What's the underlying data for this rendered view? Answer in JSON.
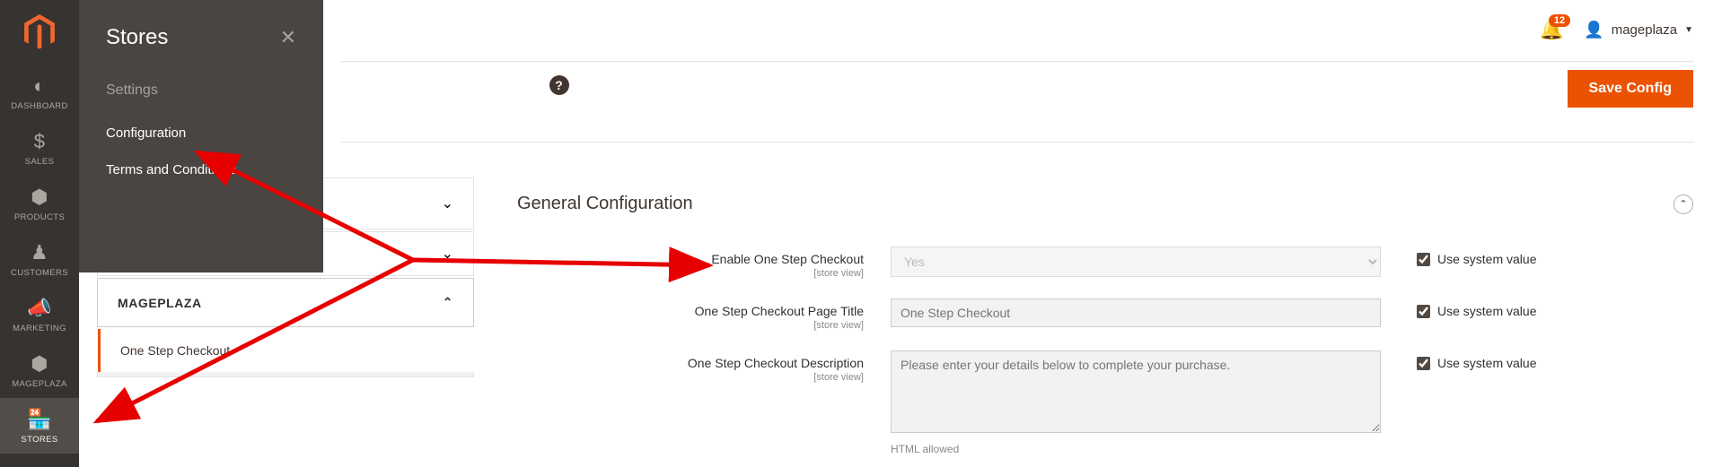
{
  "nav": {
    "items": [
      {
        "icon": "dashboard",
        "label": "DASHBOARD"
      },
      {
        "icon": "dollar",
        "label": "SALES"
      },
      {
        "icon": "cube",
        "label": "PRODUCTS"
      },
      {
        "icon": "person",
        "label": "CUSTOMERS"
      },
      {
        "icon": "megaphone",
        "label": "MARKETING"
      },
      {
        "icon": "cube",
        "label": "MAGEPLAZA"
      },
      {
        "icon": "store",
        "label": "STORES"
      }
    ],
    "active_index": 6
  },
  "flyout": {
    "title": "Stores",
    "section": "Settings",
    "links": [
      "Configuration",
      "Terms and Conditions"
    ]
  },
  "topbar": {
    "notif_count": "12",
    "user": "mageplaza"
  },
  "action": {
    "save_label": "Save Config"
  },
  "config_sidebar": {
    "expanded_section": "MAGEPLAZA",
    "active_item": "One Step Checkout"
  },
  "group": {
    "title": "General Configuration",
    "fields": {
      "enable": {
        "label": "Enable One Step Checkout",
        "scope": "[store view]",
        "value": "Yes",
        "use_system": true,
        "use_system_label": "Use system value"
      },
      "page_title": {
        "label": "One Step Checkout Page Title",
        "scope": "[store view]",
        "placeholder": "One Step Checkout",
        "use_system": true,
        "use_system_label": "Use system value"
      },
      "description": {
        "label": "One Step Checkout Description",
        "scope": "[store view]",
        "placeholder": "Please enter your details below to complete your purchase.",
        "hint": "HTML allowed",
        "use_system": true,
        "use_system_label": "Use system value"
      }
    }
  }
}
